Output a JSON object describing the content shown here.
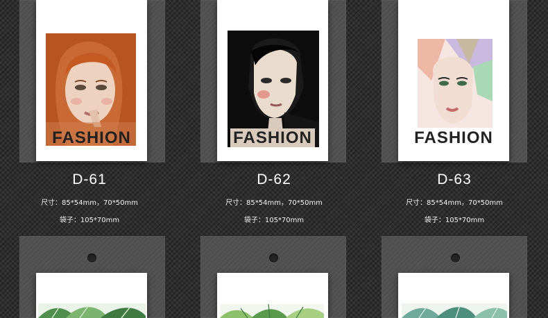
{
  "products": [
    {
      "code": "D-61",
      "badge": "FASHION",
      "size": "尺寸：85*54mm，70*50mm",
      "bag": "袋子：105*70mm",
      "illustration": "red-haired-woman-illustration"
    },
    {
      "code": "D-62",
      "badge": "FASHION",
      "size": "尺寸：85*54mm，70*50mm",
      "bag": "袋子：105*70mm",
      "illustration": "dark-haired-woman-illustration"
    },
    {
      "code": "D-63",
      "badge": "FASHION",
      "size": "尺寸：85*54mm，70*50mm",
      "bag": "袋子：105*70mm",
      "illustration": "pastel-geometric-woman-illustration"
    }
  ],
  "lower_row": [
    {
      "illustration": "tropical-leaves-illustration"
    },
    {
      "illustration": "tropical-leaves-illustration"
    },
    {
      "illustration": "tropical-leaves-illustration"
    }
  ],
  "colors": {
    "background": "#2e2e2e",
    "tag_panel": "#4f4f4f",
    "text": "#ffffff"
  }
}
